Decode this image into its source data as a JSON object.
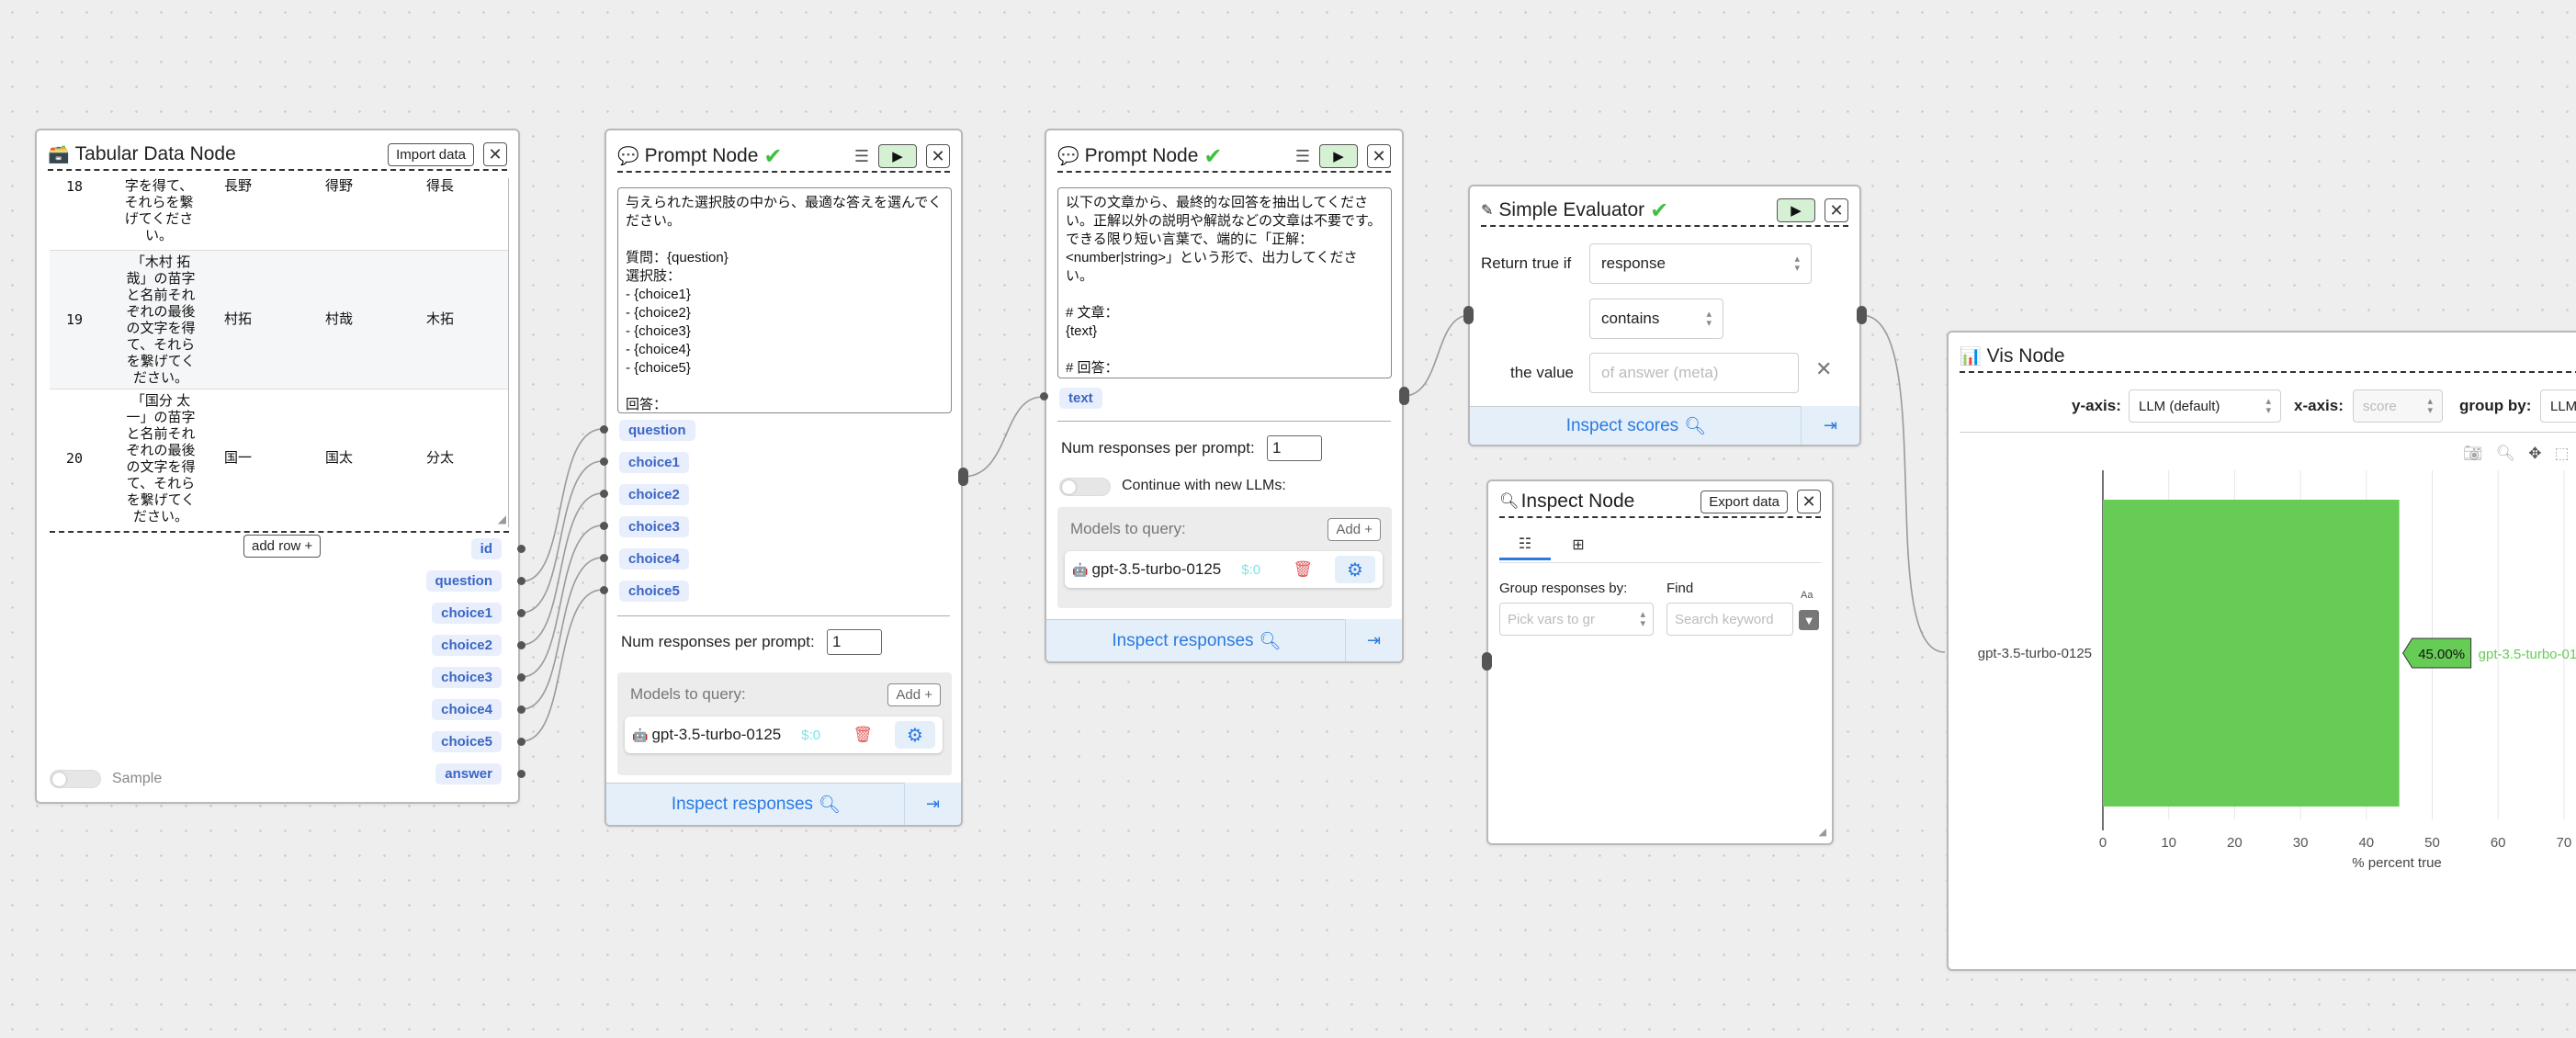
{
  "tabular": {
    "icon": "crate-icon",
    "title": "Tabular Data Node",
    "import_label": "Import data",
    "close_label": "✕",
    "rows": [
      {
        "num": "18",
        "text": "字を得て、\nそれらを繋\nげてくださ\nい。",
        "c1": "長野",
        "c2": "得野",
        "c3": "得長"
      },
      {
        "num": "19",
        "text": "「木村 拓\n哉」の苗字\nと名前それ\nぞれの最後\nの文字を得\nて、それら\nを繋げてく\nださい。",
        "c1": "村拓",
        "c2": "村哉",
        "c3": "木拓"
      },
      {
        "num": "20",
        "text": "「国分 太\n一」の苗字\nと名前それ\nぞれの最後\nの文字を得\nて、それら\nを繋げてく\nださい。",
        "c1": "国一",
        "c2": "国太",
        "c3": "分太"
      }
    ],
    "add_row_label": "add row +",
    "columns": [
      "id",
      "question",
      "choice1",
      "choice2",
      "choice3",
      "choice4",
      "choice5",
      "answer"
    ],
    "sample_label": "Sample"
  },
  "prompt1": {
    "icon": "speech-bubble-icon",
    "title": "Prompt Node",
    "check": "✔",
    "prompt_text": "与えられた選択肢の中から、最適な答えを選んでください。\n\n質問：{question}\n選択肢：\n- {choice1}\n- {choice2}\n- {choice3}\n- {choice4}\n- {choice5}\n\n回答：",
    "vars": [
      "question",
      "choice1",
      "choice2",
      "choice3",
      "choice4",
      "choice5"
    ],
    "num_responses_label": "Num responses per prompt:",
    "num_responses_value": "1",
    "models_label": "Models to query:",
    "add_label": "Add +",
    "model_name": "gpt-3.5-turbo-0125",
    "model_cost": "$:0",
    "inspect_label": "Inspect responses"
  },
  "prompt2": {
    "icon": "speech-bubble-icon",
    "title": "Prompt Node",
    "check": "✔",
    "prompt_text": "以下の文章から、最終的な回答を抽出してください。正解以外の説明や解説などの文章は不要です。できる限り短い言葉で、端的に「正解：<number|string>」という形で、出力してください。\n\n# 文章：\n{text}\n\n# 回答：",
    "vars": [
      "text"
    ],
    "num_responses_label": "Num responses per prompt:",
    "num_responses_value": "1",
    "continue_label": "Continue with new LLMs:",
    "models_label": "Models to query:",
    "add_label": "Add +",
    "model_name": "gpt-3.5-turbo-0125",
    "model_cost": "$:0",
    "inspect_label": "Inspect responses"
  },
  "evaluator": {
    "icon": "pencil-icon",
    "title": "Simple Evaluator",
    "check": "✔",
    "return_label": "Return true if",
    "response_select": "response",
    "op_select": "contains",
    "value_label": "the value",
    "value_placeholder": "of answer (meta)",
    "inspect_label": "Inspect scores"
  },
  "inspect": {
    "icon": "magnifier-icon",
    "title": "Inspect Node",
    "export_label": "Export data",
    "group_label": "Group responses by:",
    "group_placeholder": "Pick vars to gr",
    "find_label": "Find",
    "find_placeholder": "Search keyword"
  },
  "vis": {
    "icon": "bar-chart-icon",
    "title": "Vis Node",
    "yaxis_label": "y-axis:",
    "yaxis_value": "LLM (default)",
    "xaxis_label": "x-axis:",
    "xaxis_value": "score",
    "groupby_label": "group by:",
    "groupby_value": "LLM"
  },
  "chart_data": {
    "type": "bar",
    "orientation": "horizontal",
    "categories": [
      "gpt-3.5-turbo-0125"
    ],
    "series": [
      {
        "name": "gpt-3.5-turbo-0125",
        "values": [
          45
        ],
        "color": "#66cc55"
      }
    ],
    "value_label": "45.00%",
    "xlabel": "% percent true",
    "xlim": [
      0,
      70
    ],
    "xticks": [
      "0",
      "10",
      "20",
      "30",
      "40",
      "50",
      "60",
      "70"
    ],
    "grid": true
  },
  "colors": {
    "accent": "#2b7ae0",
    "tag_bg": "#e8eefc",
    "tag_text": "#3a66c4",
    "bar": "#66cc55",
    "check": "#40c040",
    "run_bg": "#d6f0d3"
  }
}
